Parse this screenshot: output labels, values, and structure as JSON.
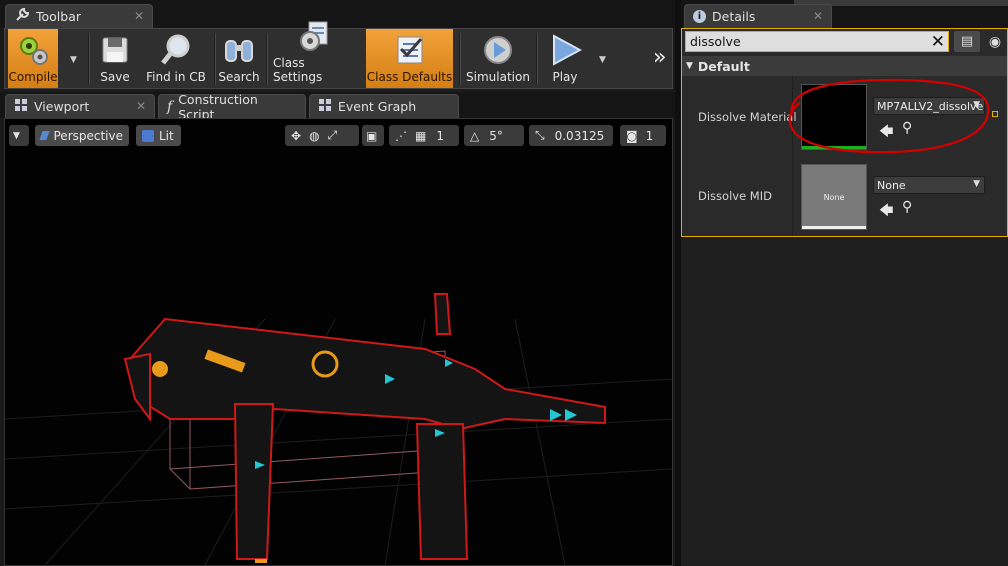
{
  "panels": {
    "toolbar_tab": "Toolbar",
    "details_tab": "Details"
  },
  "toolbar": {
    "compile": "Compile",
    "save": "Save",
    "find_in_cb": "Find in CB",
    "search": "Search",
    "class_settings": "Class Settings",
    "class_defaults": "Class Defaults",
    "simulation": "Simulation",
    "play": "Play",
    "overflow": "»"
  },
  "editor_tabs": {
    "viewport": "Viewport",
    "construction_script": "Construction Script",
    "event_graph": "Event Graph"
  },
  "viewport": {
    "perspective": "Perspective",
    "lit": "Lit",
    "grid_snap": "1",
    "rotation_snap": "5°",
    "scale_snap": "0.03125",
    "camera_speed": "1"
  },
  "details": {
    "search_value": "dissolve",
    "category": "Default",
    "properties": [
      {
        "label": "Dissolve Material",
        "value": "MP7ALLV2_dissolve",
        "thumb_label": ""
      },
      {
        "label": "Dissolve MID",
        "value": "None",
        "thumb_label": "None"
      }
    ]
  },
  "colors": {
    "accent_orange": "#e8941f",
    "highlight_yellow": "#e3b000",
    "annotation_red": "#d40000"
  }
}
